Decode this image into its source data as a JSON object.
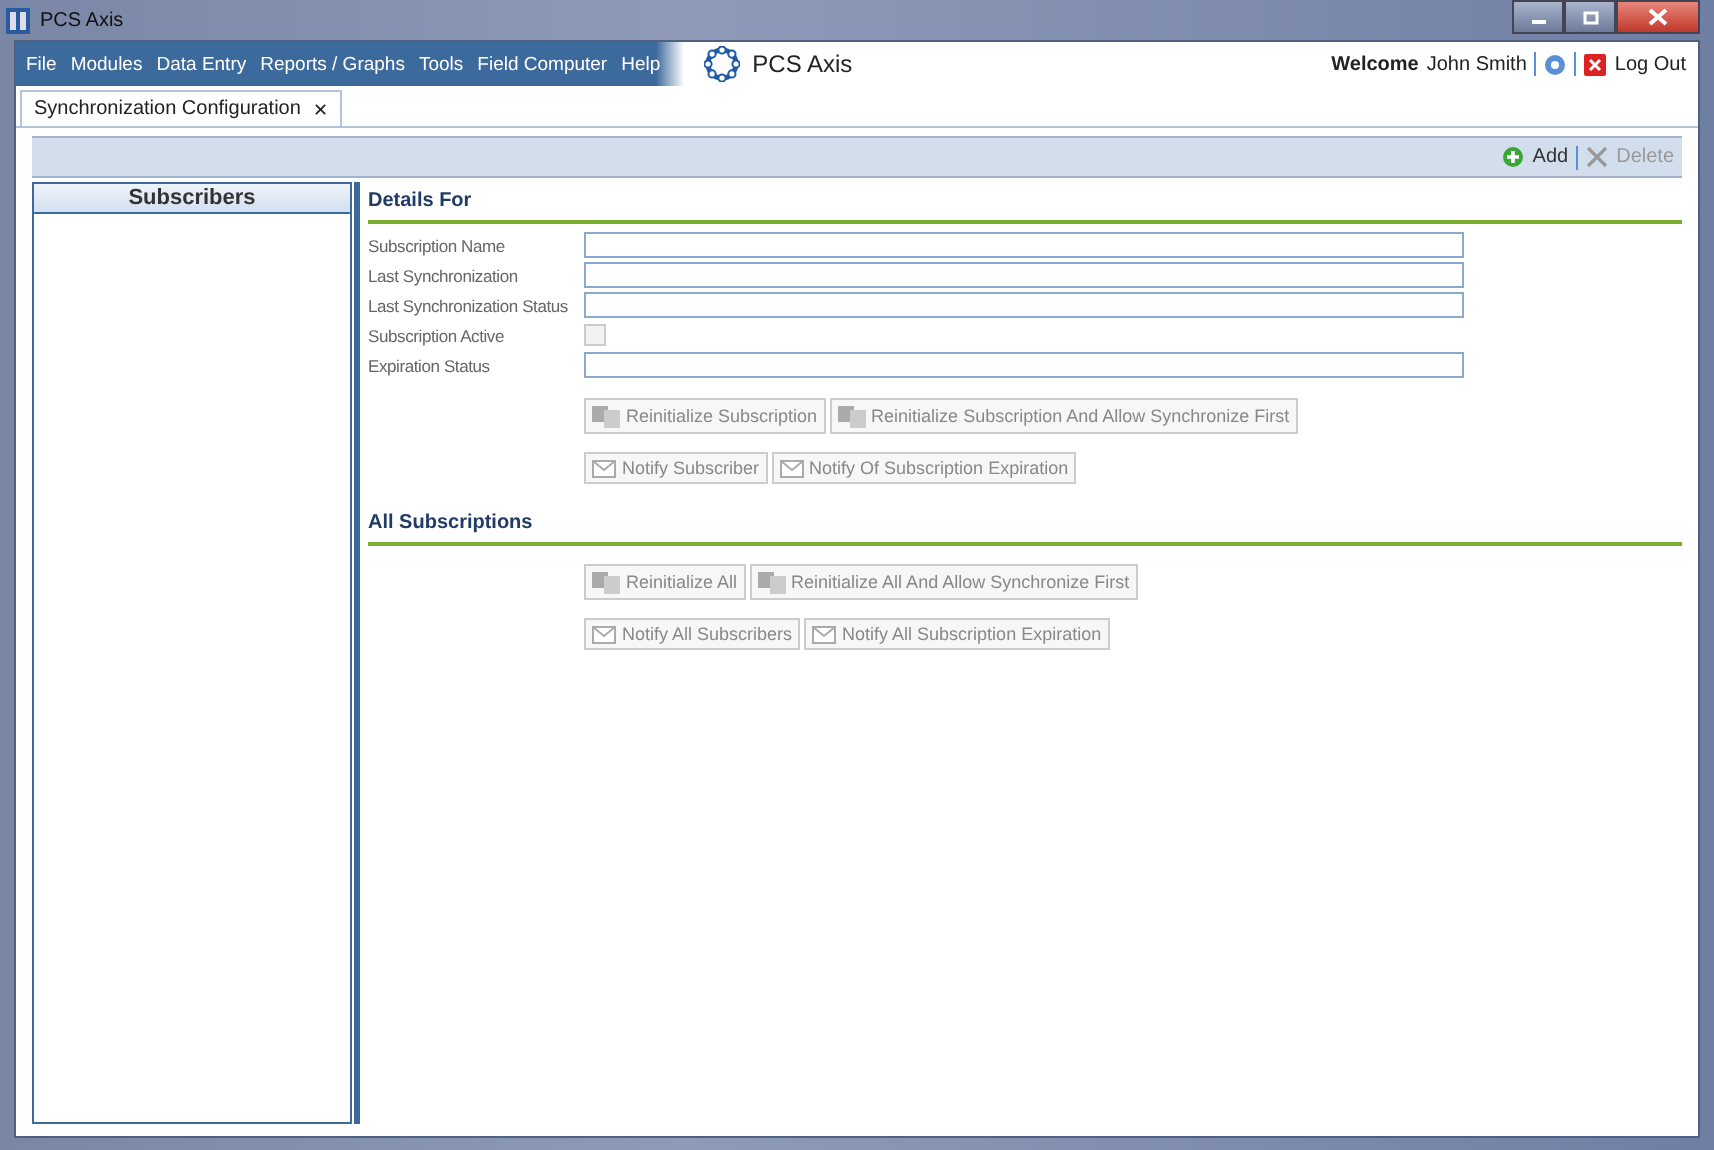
{
  "window": {
    "title": "PCS Axis"
  },
  "menu": [
    "File",
    "Modules",
    "Data Entry",
    "Reports / Graphs",
    "Tools",
    "Field Computer",
    "Help"
  ],
  "brand": "PCS Axis",
  "user": {
    "welcome": "Welcome",
    "name": "John Smith",
    "logout": "Log Out"
  },
  "tabs": [
    {
      "label": "Synchronization Configuration",
      "close": "✕",
      "selected": true
    }
  ],
  "toolbar": [
    {
      "label": "Add",
      "kind": "add",
      "disabled": false
    },
    {
      "label": "Delete",
      "kind": "delete",
      "disabled": true
    }
  ],
  "subscribers": {
    "title": "Subscribers"
  },
  "details": {
    "title": "Details For",
    "fields": [
      {
        "label": "Subscription Name",
        "kind": "text"
      },
      {
        "label": "Last Synchronization",
        "kind": "text"
      },
      {
        "label": "Last Synchronization Status",
        "kind": "text"
      },
      {
        "label": "Subscription Active",
        "kind": "checkbox",
        "checked": false
      },
      {
        "label": "Expiration Status",
        "kind": "text"
      }
    ],
    "button_rows": [
      [
        {
          "label": "Reinitialize Subscription",
          "kind": "reinit",
          "disabled": true
        },
        {
          "label": "Reinitialize Subscription And Allow Synchronize First",
          "kind": "reinit",
          "disabled": true
        }
      ],
      [
        {
          "label": "Notify Subscriber",
          "kind": "mail",
          "disabled": true
        },
        {
          "label": "Notify Of Subscription Expiration",
          "kind": "mail",
          "disabled": true
        }
      ]
    ]
  },
  "all": {
    "title": "All Subscriptions",
    "button_rows": [
      [
        {
          "label": "Reinitialize All",
          "kind": "reinit",
          "disabled": true
        },
        {
          "label": "Reinitialize All And Allow Synchronize First",
          "kind": "reinit",
          "disabled": true
        }
      ],
      [
        {
          "label": "Notify All Subscribers",
          "kind": "mail",
          "disabled": true
        },
        {
          "label": "Notify All Subscription Expiration",
          "kind": "mail",
          "disabled": true
        }
      ]
    ]
  }
}
